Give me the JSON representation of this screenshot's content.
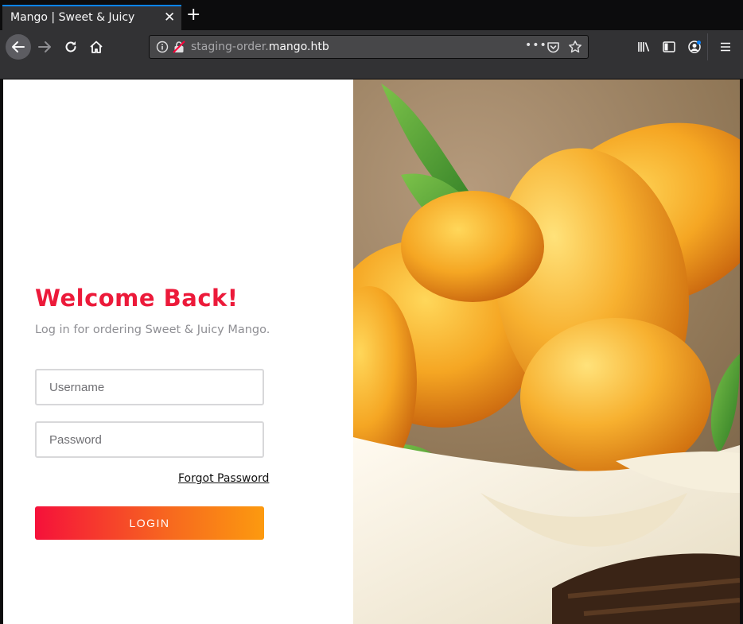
{
  "browser": {
    "tab_title": "Mango | Sweet & Juicy",
    "tab_close": "✕",
    "new_tab": "+",
    "url_prefix": "staging-order.",
    "url_domain": "mango.htb",
    "url_more": "•••"
  },
  "login": {
    "heading": "Welcome Back!",
    "subtitle": "Log in for ordering Sweet & Juicy Mango.",
    "username_placeholder": "Username",
    "password_placeholder": "Password",
    "forgot_label": "Forgot Password",
    "login_label": "LOGIN"
  },
  "hero": {
    "image": "mangoes-in-basket-photo"
  },
  "colors": {
    "accent": "#ec1a3a",
    "gradient_start": "#f5113a",
    "gradient_end": "#fc9a0f",
    "browser_chrome": "#323234"
  }
}
